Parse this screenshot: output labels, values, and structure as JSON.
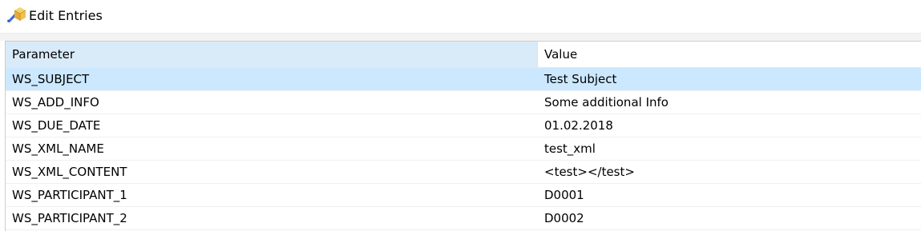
{
  "window": {
    "title": "Edit Entries",
    "icon": "edit-entries-icon"
  },
  "table": {
    "columns": [
      "Parameter",
      "Value"
    ],
    "selected_row_index": 0,
    "rows": [
      {
        "parameter": "WS_SUBJECT",
        "value": "Test Subject"
      },
      {
        "parameter": "WS_ADD_INFO",
        "value": "Some additional Info"
      },
      {
        "parameter": "WS_DUE_DATE",
        "value": "01.02.2018"
      },
      {
        "parameter": "WS_XML_NAME",
        "value": "test_xml"
      },
      {
        "parameter": "WS_XML_CONTENT",
        "value": "<test></test>"
      },
      {
        "parameter": "WS_PARTICIPANT_1",
        "value": "D0001"
      },
      {
        "parameter": "WS_PARTICIPANT_2",
        "value": "D0002"
      }
    ]
  },
  "colors": {
    "selection": "#cce8ff",
    "header_sorted": "#d9ebf9"
  }
}
